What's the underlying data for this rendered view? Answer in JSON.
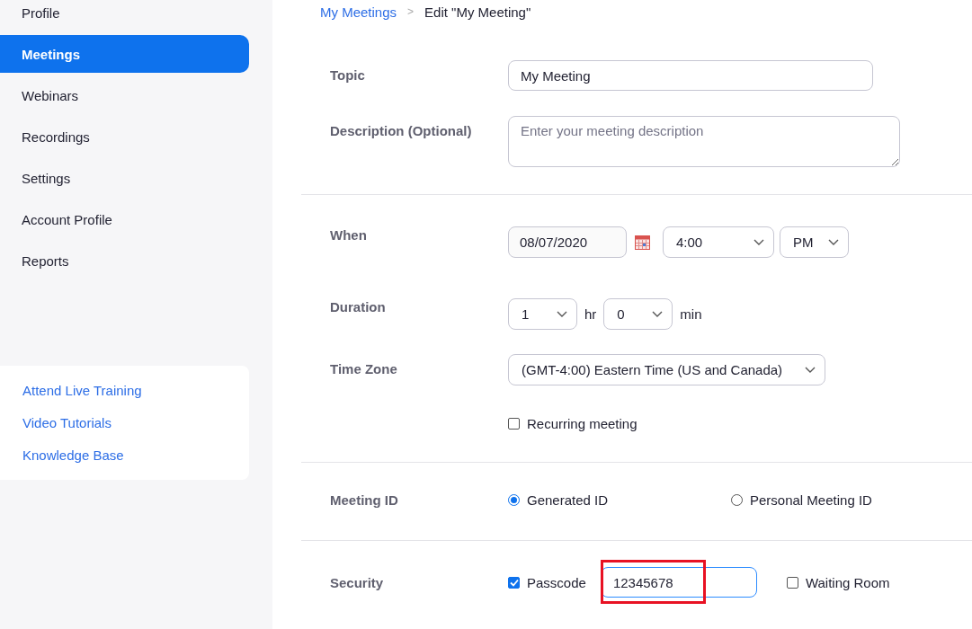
{
  "sidebar": {
    "nav_items": [
      {
        "label": "Profile",
        "selected": false
      },
      {
        "label": "Meetings",
        "selected": true
      },
      {
        "label": "Webinars",
        "selected": false
      },
      {
        "label": "Recordings",
        "selected": false
      },
      {
        "label": "Settings",
        "selected": false
      },
      {
        "label": "Account Profile",
        "selected": false
      },
      {
        "label": "Reports",
        "selected": false
      }
    ],
    "links": [
      "Attend Live Training",
      "Video Tutorials",
      "Knowledge Base"
    ]
  },
  "breadcrumb": {
    "parent": "My Meetings",
    "separator": ">",
    "current": "Edit \"My Meeting\""
  },
  "form": {
    "topic": {
      "label": "Topic",
      "value": "My Meeting"
    },
    "description": {
      "label": "Description (Optional)",
      "placeholder": "Enter your meeting description"
    },
    "when": {
      "label": "When",
      "date": "08/07/2020",
      "time": "4:00",
      "ampm": "PM"
    },
    "duration": {
      "label": "Duration",
      "hours": "1",
      "hours_unit": "hr",
      "minutes": "0",
      "minutes_unit": "min"
    },
    "time_zone": {
      "label": "Time Zone",
      "value": "(GMT-4:00) Eastern Time (US and Canada)"
    },
    "recurring": {
      "label": "Recurring meeting",
      "checked": false
    },
    "meeting_id": {
      "label": "Meeting ID",
      "options": [
        {
          "label": "Generated ID",
          "selected": true
        },
        {
          "label": "Personal Meeting ID",
          "selected": false
        }
      ]
    },
    "security": {
      "label": "Security",
      "passcode": {
        "label": "Passcode",
        "checked": true,
        "value": "12345678",
        "highlighted": true
      },
      "waiting_room": {
        "label": "Waiting Room",
        "checked": false
      }
    }
  }
}
